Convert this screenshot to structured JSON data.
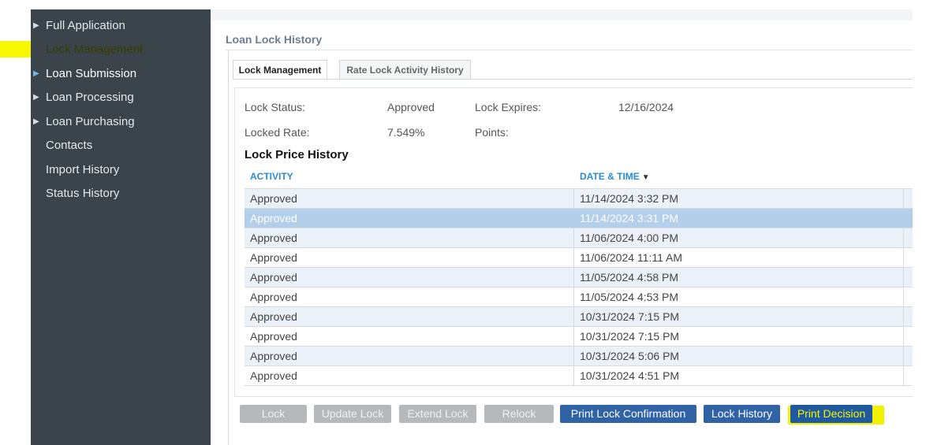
{
  "sidebar": {
    "items": [
      {
        "label": "Full Application",
        "caret": "▶"
      },
      {
        "label": "Lock Management",
        "caret": ""
      },
      {
        "label": "Loan Submission",
        "caret": "▶"
      },
      {
        "label": "Loan Processing",
        "caret": "▶"
      },
      {
        "label": "Loan Purchasing",
        "caret": "▶"
      },
      {
        "label": "Contacts",
        "caret": ""
      },
      {
        "label": "Import History",
        "caret": ""
      },
      {
        "label": "Status History",
        "caret": ""
      }
    ]
  },
  "main": {
    "title": "Loan Lock History",
    "tabs": [
      {
        "label": "Lock Management"
      },
      {
        "label": "Rate Lock Activity History"
      }
    ],
    "fields": {
      "lock_status_label": "Lock Status:",
      "lock_status_value": "Approved",
      "lock_expires_label": "Lock Expires:",
      "lock_expires_value": "12/16/2024",
      "locked_rate_label": "Locked Rate:",
      "locked_rate_value": "7.549%",
      "points_label": "Points:",
      "points_value": ""
    },
    "section_title": "Lock Price History",
    "table": {
      "headers": [
        "ACTIVITY",
        "DATE & TIME"
      ],
      "sort_indicator": "▼",
      "rows": [
        {
          "activity": "Approved",
          "datetime": "11/14/2024 3:32 PM"
        },
        {
          "activity": "Approved",
          "datetime": "11/14/2024 3:31 PM"
        },
        {
          "activity": "Approved",
          "datetime": "11/06/2024 4:00 PM"
        },
        {
          "activity": "Approved",
          "datetime": "11/06/2024 11:11 AM"
        },
        {
          "activity": "Approved",
          "datetime": "11/05/2024 4:58 PM"
        },
        {
          "activity": "Approved",
          "datetime": "11/05/2024 4:53 PM"
        },
        {
          "activity": "Approved",
          "datetime": "10/31/2024 7:15 PM"
        },
        {
          "activity": "Approved",
          "datetime": "10/31/2024 7:15 PM"
        },
        {
          "activity": "Approved",
          "datetime": "10/31/2024 5:06 PM"
        },
        {
          "activity": "Approved",
          "datetime": "10/31/2024 4:51 PM"
        }
      ]
    },
    "buttons": {
      "lock": "Lock",
      "update_lock": "Update Lock",
      "extend_lock": "Extend Lock",
      "relock": "Relock",
      "print_lock_confirmation": "Print Lock Confirmation",
      "lock_history": "Lock History",
      "print_decision": "Print Decision"
    }
  },
  "colors": {
    "sidebar_bg": "#3b444b",
    "accent_blue": "#2a8bd4",
    "button_primary": "#2f63a6",
    "button_disabled": "#b6b9bc",
    "highlight_yellow": "#f7f700",
    "selected_row": "#b4cfea"
  }
}
